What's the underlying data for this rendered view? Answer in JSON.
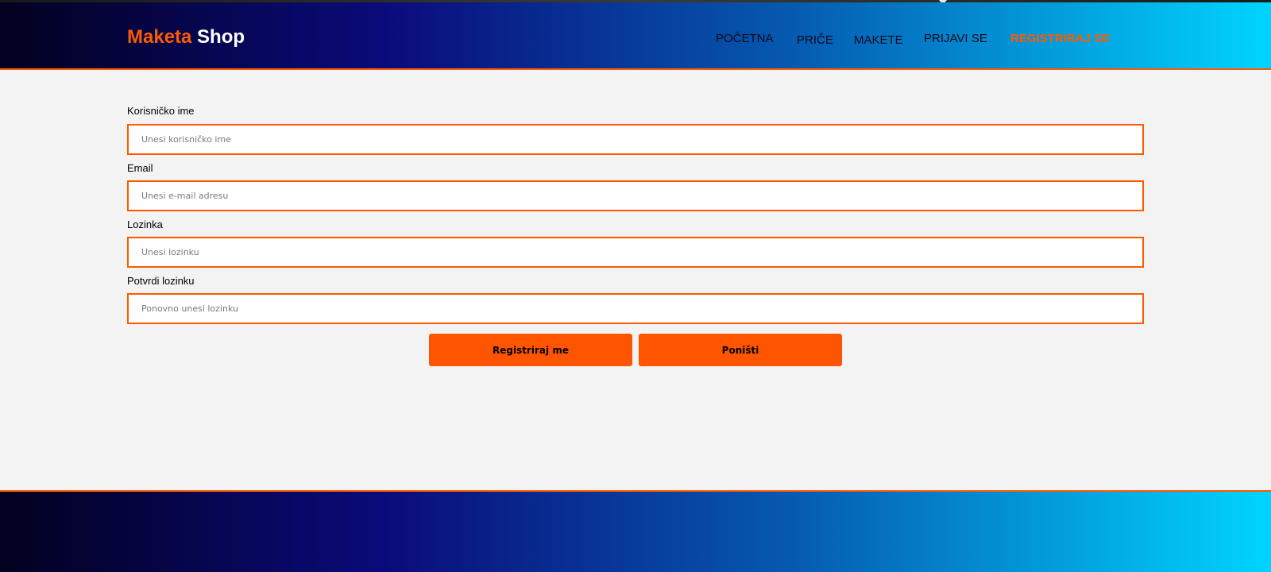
{
  "header": {
    "logo_part1": "Maketa",
    "logo_part2": "Shop",
    "nav": [
      {
        "label": "POČETNA"
      },
      {
        "label": "PRIČE"
      },
      {
        "label": "MAKETE"
      },
      {
        "label": "PRIJAVI SE"
      },
      {
        "label": "REGISTRIRAJ SE",
        "active": true
      }
    ]
  },
  "form": {
    "fields": [
      {
        "label": "Korisničko ime",
        "placeholder": "Unesi korisničko ime",
        "value": ""
      },
      {
        "label": "Email",
        "placeholder": "Unesi e-mail adresu",
        "value": ""
      },
      {
        "label": "Lozinka",
        "placeholder": "Unesi lozinku",
        "value": ""
      },
      {
        "label": "Potvrdi lozinku",
        "placeholder": "Ponovno unesi lozinku",
        "value": ""
      }
    ],
    "submit_label": "Registriraj me",
    "reset_label": "Poništi"
  },
  "colors": {
    "accent": "#ff5a00",
    "header_gradient_start": "#02011f",
    "header_gradient_mid": "#0a0a7a",
    "header_gradient_end": "#00d4ff",
    "content_background": "#f3f3f3"
  },
  "icons": {
    "cursor": "mouse-cursor-icon"
  }
}
